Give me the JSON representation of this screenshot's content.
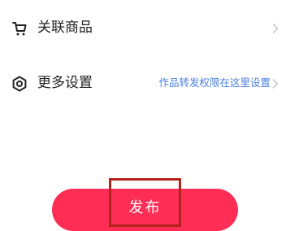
{
  "settings": {
    "related_products": {
      "label": "关联商品",
      "icon": "cart-icon"
    },
    "more_settings": {
      "label": "更多设置",
      "hint": "作品转发权限在这里设置",
      "icon": "settings-icon"
    }
  },
  "publish": {
    "label": "发布"
  },
  "colors": {
    "accent": "#fd2d55",
    "link": "#4a7fe0",
    "highlight": "#b3221d"
  }
}
